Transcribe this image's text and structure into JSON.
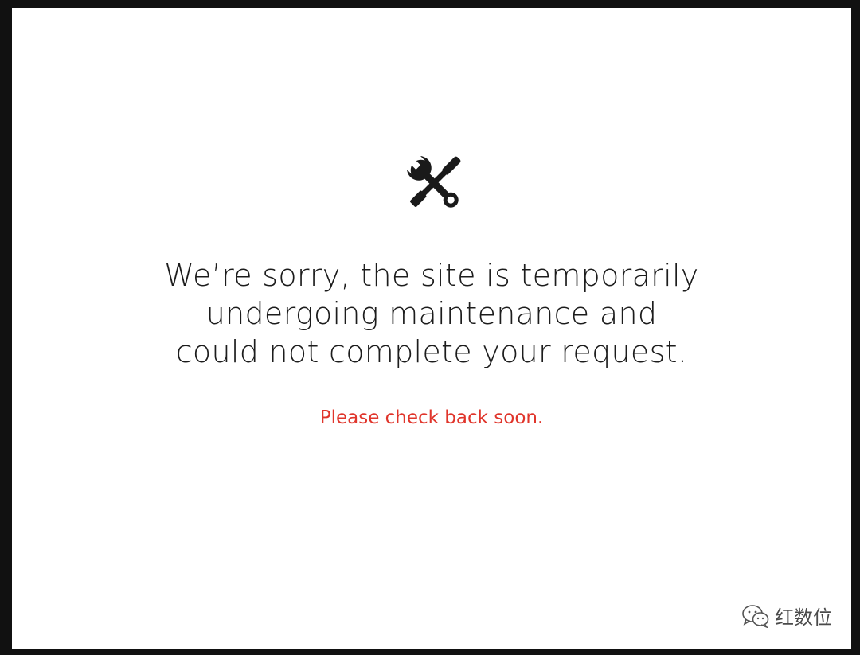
{
  "page": {
    "icon": "tools-icon",
    "message_lines": [
      "We’re sorry, the site is temporarily",
      "undergoing maintenance and",
      "could not complete your request."
    ],
    "subtext": "Please check back soon.",
    "subtext_color": "#e0352b"
  },
  "watermark": {
    "icon": "wechat-icon",
    "text": "红数位"
  }
}
